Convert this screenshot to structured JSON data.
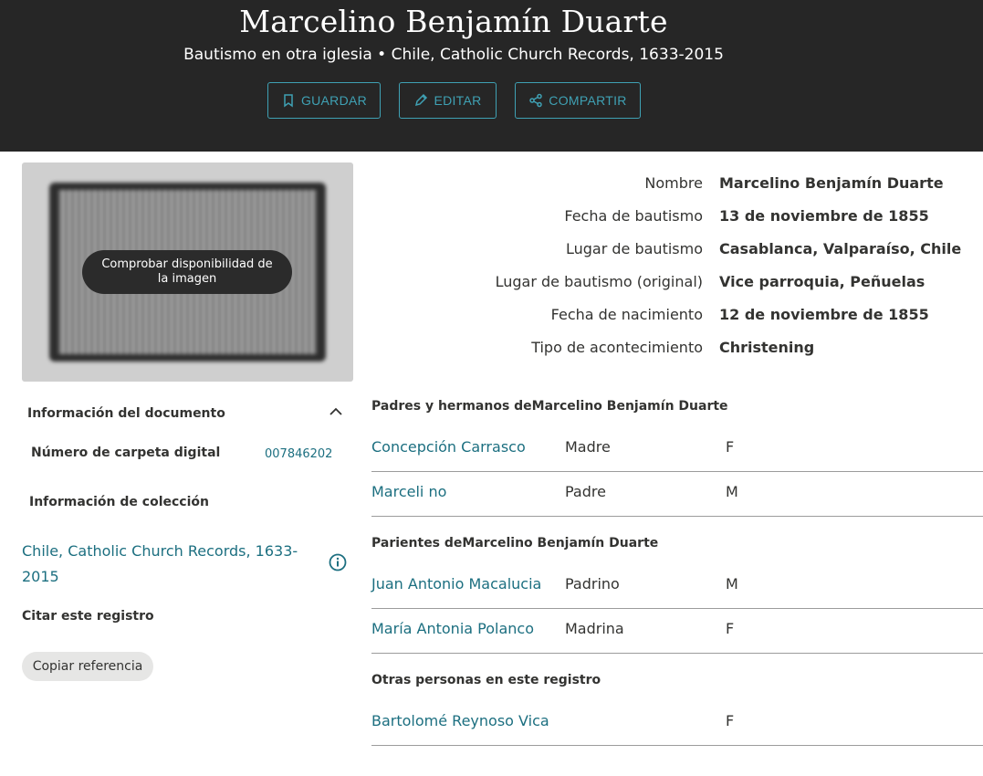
{
  "header": {
    "title": "Marcelino Benjamín Duarte",
    "subtitle": "Bautismo en otra iglesia • Chile, Catholic Church Records, 1633-2015",
    "buttons": {
      "save": "GUARDAR",
      "edit": "EDITAR",
      "share": "COMPARTIR"
    }
  },
  "image": {
    "availability_label": "Comprobar disponibilidad de la imagen"
  },
  "document_info": {
    "title": "Información del documento",
    "folder_label": "Número de carpeta digital",
    "folder_value": "007846202",
    "collection_label": "Información de colección",
    "collection_link": "Chile, Catholic Church Records, 1633-2015",
    "cite_label": "Citar este registro",
    "copy_button": "Copiar referencia"
  },
  "facts": [
    {
      "label": "Nombre",
      "value": "Marcelino Benjamín Duarte"
    },
    {
      "label": "Fecha de bautismo",
      "value": "13 de noviembre de 1855"
    },
    {
      "label": "Lugar de bautismo",
      "value": "Casablanca, Valparaíso, Chile"
    },
    {
      "label": "Lugar de bautismo (original)",
      "value": "Vice parroquia, Peñuelas"
    },
    {
      "label": "Fecha de nacimiento",
      "value": "12 de noviembre de 1855"
    },
    {
      "label": "Tipo de acontecimiento",
      "value": "Christening"
    }
  ],
  "parents": {
    "title": "Padres y hermanos deMarcelino Benjamín Duarte",
    "rows": [
      {
        "name": "Concepción Carrasco",
        "role": "Madre",
        "sex": "F"
      },
      {
        "name": "Marceli no",
        "role": "Padre",
        "sex": "M"
      }
    ]
  },
  "relatives": {
    "title": "Parientes deMarcelino Benjamín Duarte",
    "rows": [
      {
        "name": "Juan Antonio Macalucia",
        "role": "Padrino",
        "sex": "M"
      },
      {
        "name": "María Antonia Polanco",
        "role": "Madrina",
        "sex": "F"
      }
    ]
  },
  "others": {
    "title": "Otras personas en este registro",
    "rows": [
      {
        "name": "Bartolomé Reynoso Vica",
        "role": "",
        "sex": "F"
      }
    ]
  },
  "colors": {
    "header_bg": "#262626",
    "accent": "#3fa1b4",
    "link": "#1c6f80"
  }
}
